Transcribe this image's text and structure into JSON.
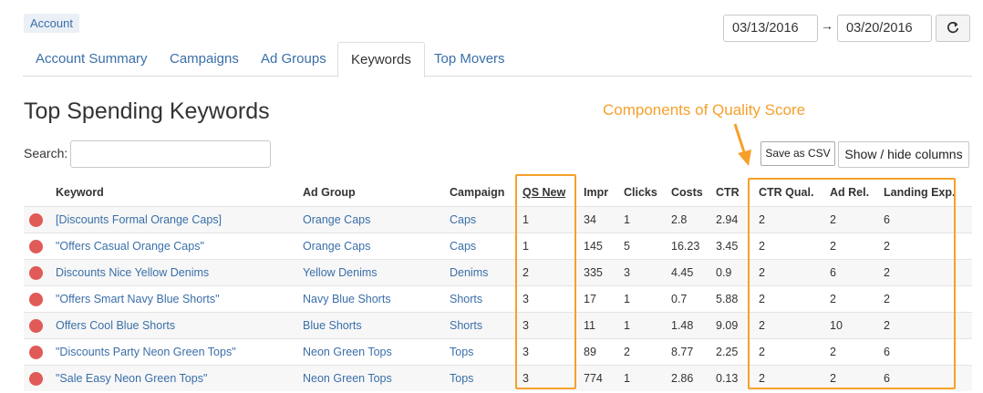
{
  "account_label": "Account",
  "date_range": {
    "start": "03/13/2016",
    "end": "03/20/2016",
    "separator": "→"
  },
  "refresh_icon": "refresh-icon",
  "tabs": [
    {
      "label": "Account Summary"
    },
    {
      "label": "Campaigns"
    },
    {
      "label": "Ad Groups"
    },
    {
      "label": "Keywords",
      "active": true
    },
    {
      "label": "Top Movers"
    }
  ],
  "page_title": "Top Spending Keywords",
  "annotation": "Components of Quality Score",
  "search": {
    "label": "Search:",
    "value": ""
  },
  "buttons": {
    "save_csv": "Save as CSV",
    "show_hide": "Show / hide columns"
  },
  "columns": {
    "keyword": "Keyword",
    "ad_group": "Ad Group",
    "campaign": "Campaign",
    "qs_new": "QS New",
    "impr": "Impr",
    "clicks": "Clicks",
    "costs": "Costs",
    "ctr": "CTR",
    "ctr_qual": "CTR Qual.",
    "ad_rel": "Ad Rel.",
    "landing_exp": "Landing Exp."
  },
  "rows": [
    {
      "keyword": "[Discounts Formal Orange Caps]",
      "ad_group": "Orange Caps",
      "campaign": "Caps",
      "qs_new": "1",
      "impr": "34",
      "clicks": "1",
      "costs": "2.8",
      "ctr": "2.94",
      "ctr_qual": "2",
      "ad_rel": "2",
      "landing_exp": "6"
    },
    {
      "keyword": "\"Offers Casual Orange Caps\"",
      "ad_group": "Orange Caps",
      "campaign": "Caps",
      "qs_new": "1",
      "impr": "145",
      "clicks": "5",
      "costs": "16.23",
      "ctr": "3.45",
      "ctr_qual": "2",
      "ad_rel": "2",
      "landing_exp": "2"
    },
    {
      "keyword": "Discounts Nice Yellow Denims",
      "ad_group": "Yellow Denims",
      "campaign": "Denims",
      "qs_new": "2",
      "impr": "335",
      "clicks": "3",
      "costs": "4.45",
      "ctr": "0.9",
      "ctr_qual": "2",
      "ad_rel": "6",
      "landing_exp": "2"
    },
    {
      "keyword": "\"Offers Smart Navy Blue Shorts\"",
      "ad_group": "Navy Blue Shorts",
      "campaign": "Shorts",
      "qs_new": "3",
      "impr": "17",
      "clicks": "1",
      "costs": "0.7",
      "ctr": "5.88",
      "ctr_qual": "2",
      "ad_rel": "2",
      "landing_exp": "2"
    },
    {
      "keyword": "Offers Cool Blue Shorts",
      "ad_group": "Blue Shorts",
      "campaign": "Shorts",
      "qs_new": "3",
      "impr": "11",
      "clicks": "1",
      "costs": "1.48",
      "ctr": "9.09",
      "ctr_qual": "2",
      "ad_rel": "10",
      "landing_exp": "2"
    },
    {
      "keyword": "\"Discounts Party Neon Green Tops\"",
      "ad_group": "Neon Green Tops",
      "campaign": "Tops",
      "qs_new": "3",
      "impr": "89",
      "clicks": "2",
      "costs": "8.77",
      "ctr": "2.25",
      "ctr_qual": "2",
      "ad_rel": "2",
      "landing_exp": "6"
    },
    {
      "keyword": "\"Sale Easy Neon Green Tops\"",
      "ad_group": "Neon Green Tops",
      "campaign": "Tops",
      "qs_new": "3",
      "impr": "774",
      "clicks": "1",
      "costs": "2.86",
      "ctr": "0.13",
      "ctr_qual": "2",
      "ad_rel": "2",
      "landing_exp": "6"
    }
  ],
  "colors": {
    "link": "#3a6fa8",
    "highlight": "#f5a02c",
    "status_dot": "#e05a57"
  }
}
